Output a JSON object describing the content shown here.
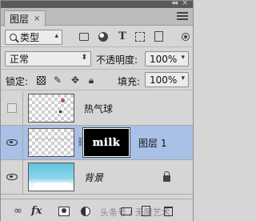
{
  "window": {
    "tab_label": "图层",
    "tab_close": "×",
    "collapse_glyph": "◂◂",
    "close_glyph": "×"
  },
  "filter": {
    "kind_label": "类型",
    "icons": [
      "image-filter-icon",
      "adjustment-filter-icon",
      "type-filter-icon",
      "shape-filter-icon",
      "smart-object-filter-icon"
    ]
  },
  "blend": {
    "mode": "正常",
    "opacity_label": "不透明度:",
    "opacity_value": "100%"
  },
  "lock": {
    "label": "锁定:",
    "fill_label": "填充:",
    "fill_value": "100%"
  },
  "layers": [
    {
      "name": "热气球",
      "visible": false,
      "selected": false,
      "thumb": "transparent"
    },
    {
      "name": "图层 1",
      "visible": true,
      "selected": true,
      "thumb": "transparent",
      "mask_text": "milk"
    },
    {
      "name": "背景",
      "visible": true,
      "selected": false,
      "thumb": "sky",
      "locked": true
    }
  ],
  "bottom": {
    "link": "∞",
    "fx": "fx",
    "watermark": "头条号 / 无限艺术"
  }
}
